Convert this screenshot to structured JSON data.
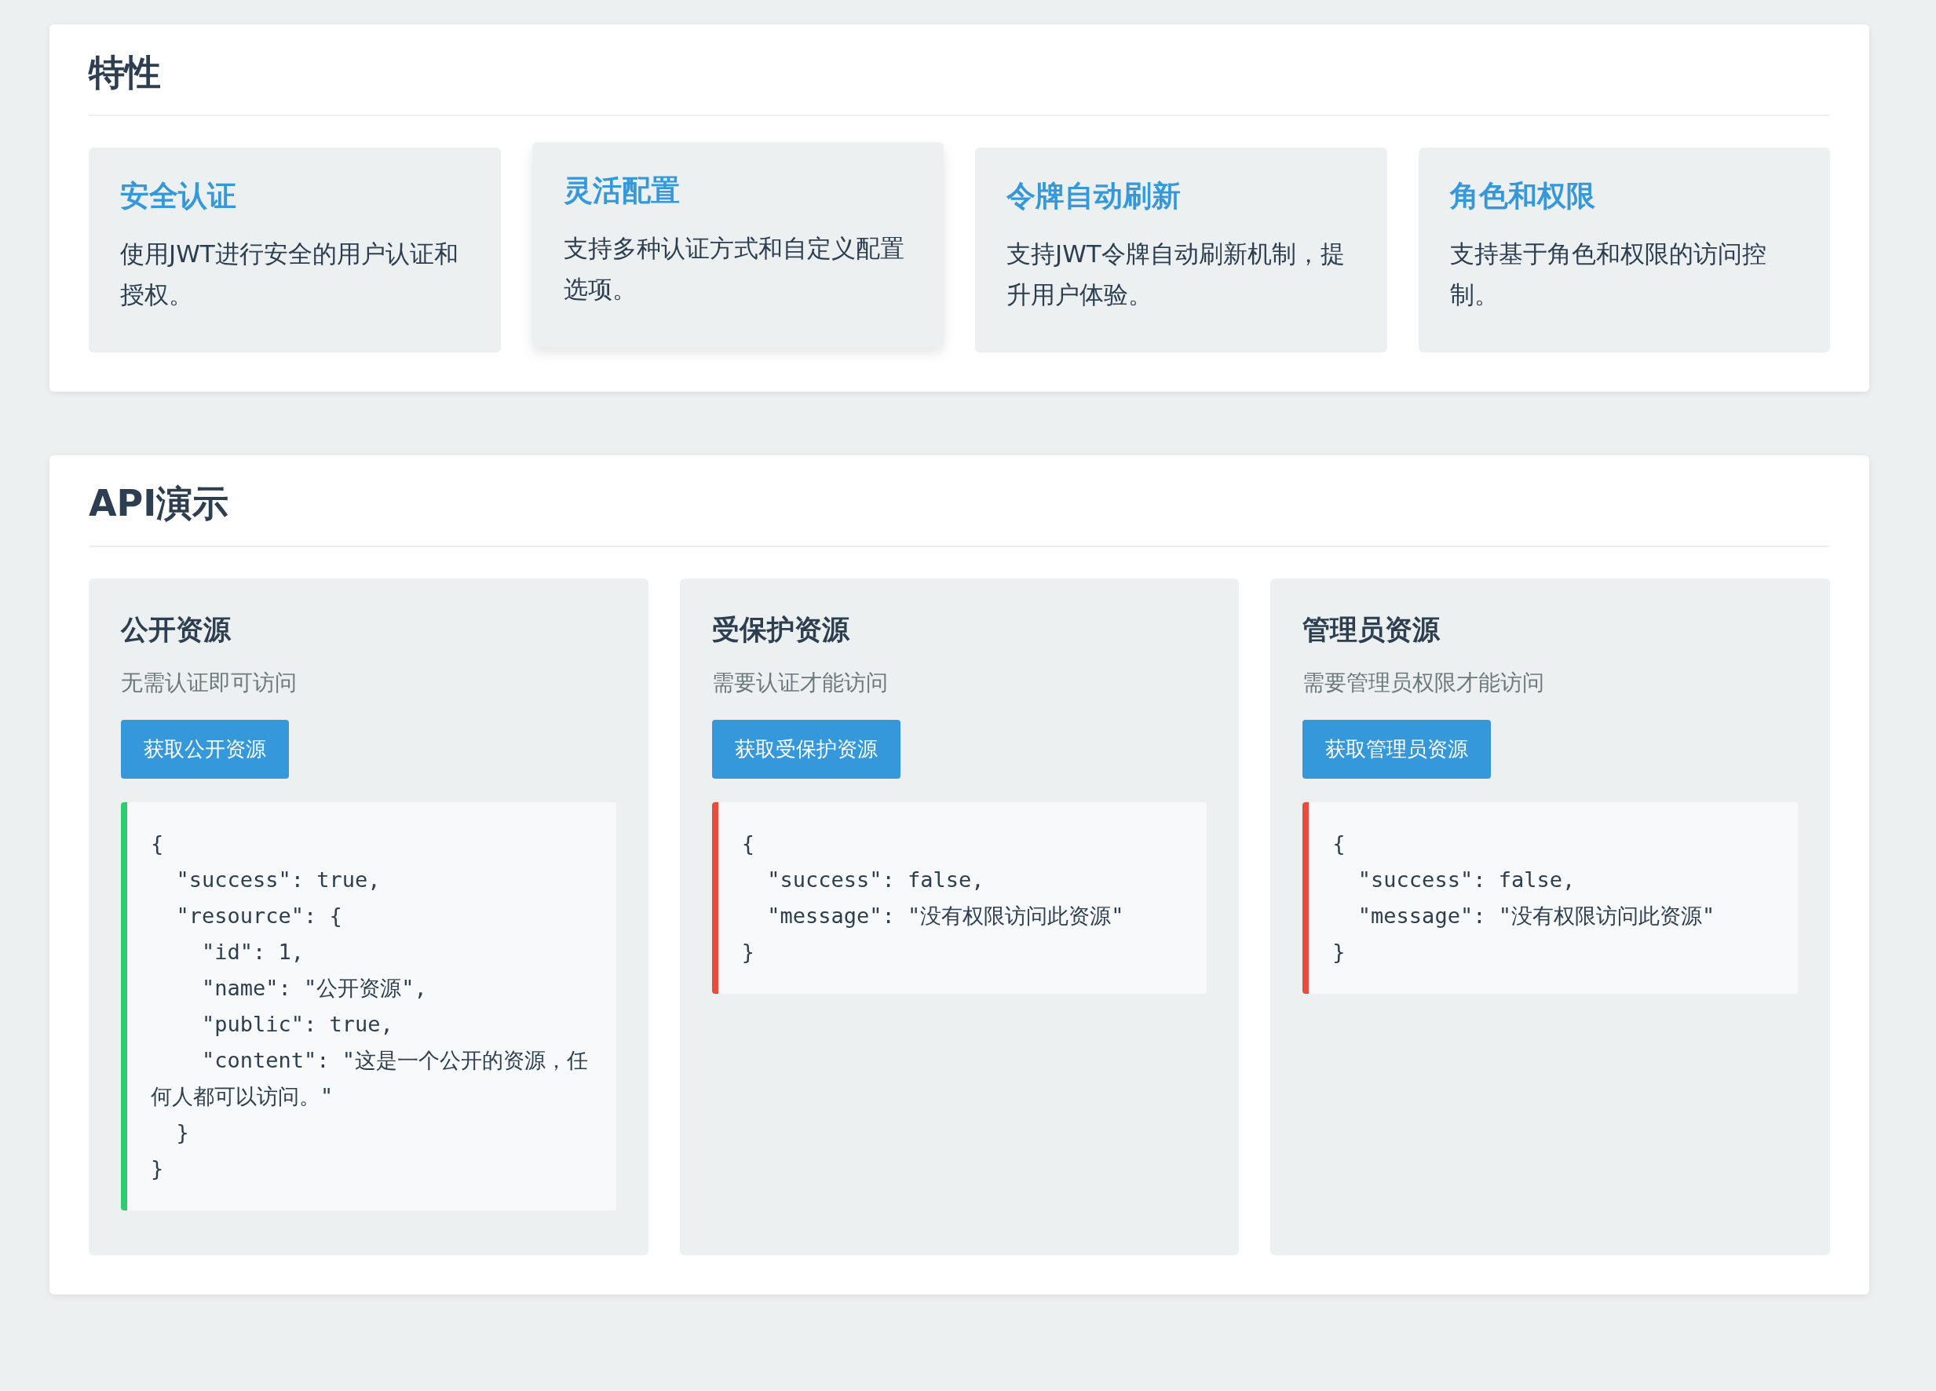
{
  "features": {
    "title": "特性",
    "items": [
      {
        "title": "安全认证",
        "description": "使用JWT进行安全的用户认证和授权。",
        "hovered": false
      },
      {
        "title": "灵活配置",
        "description": "支持多种认证方式和自定义配置选项。",
        "hovered": true
      },
      {
        "title": "令牌自动刷新",
        "description": "支持JWT令牌自动刷新机制，提升用户体验。",
        "hovered": false
      },
      {
        "title": "角色和权限",
        "description": "支持基于角色和权限的访问控制。",
        "hovered": false
      }
    ]
  },
  "api_demo": {
    "title": "API演示",
    "panels": [
      {
        "title": "公开资源",
        "subtitle": "无需认证即可访问",
        "button": "获取公开资源",
        "result": {
          "color": "#2ecc71",
          "text": "{\n  \"success\": true,\n  \"resource\": {\n    \"id\": 1,\n    \"name\": \"公开资源\",\n    \"public\": true,\n    \"content\": \"这是一个公开的资源，任何人都可以访问。\"\n  }\n}"
        }
      },
      {
        "title": "受保护资源",
        "subtitle": "需要认证才能访问",
        "button": "获取受保护资源",
        "result": {
          "color": "#e74c3c",
          "text": "{\n  \"success\": false,\n  \"message\": \"没有权限访问此资源\"\n}"
        }
      },
      {
        "title": "管理员资源",
        "subtitle": "需要管理员权限才能访问",
        "button": "获取管理员资源",
        "result": {
          "color": "#e74c3c",
          "text": "{\n  \"success\": false,\n  \"message\": \"没有权限访问此资源\"\n}"
        }
      }
    ]
  }
}
